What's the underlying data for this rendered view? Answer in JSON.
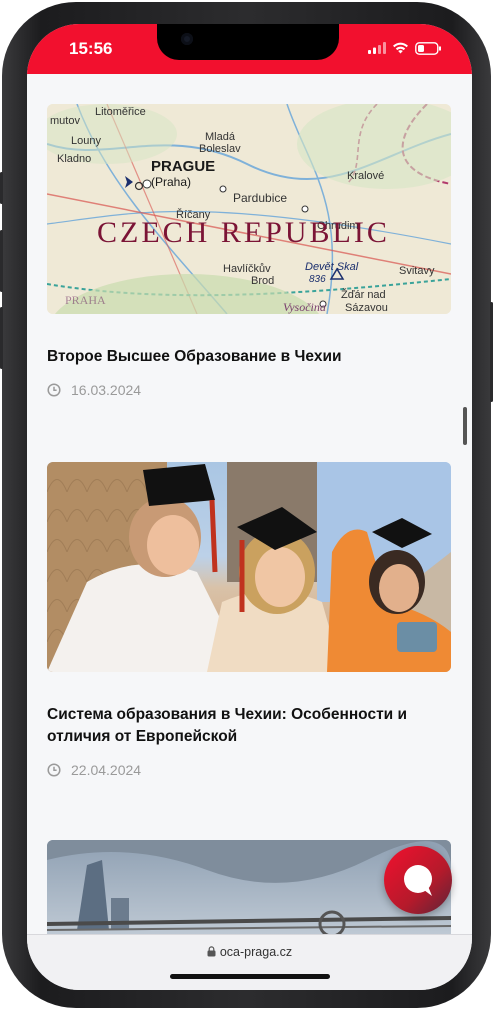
{
  "status_bar": {
    "time": "15:56"
  },
  "articles": [
    {
      "title": "Второе Высшее Образование в Чехии",
      "date": "16.03.2024",
      "image_text": {
        "country": "CZECH REPUBLIC",
        "capital": "PRAGUE",
        "capital_local": "(Praha)",
        "places": [
          "Litoměřice",
          "mutov",
          "Louny",
          "Mladá",
          "Boleslav",
          "Kladno",
          "Pardubice",
          "Říčany",
          "Chrudim",
          "Kralové",
          "Havlíčkův",
          "Brod",
          "Devět Skal",
          "836",
          "Žďár nad",
          "Sázavou",
          "Svitavy",
          "Vysočina",
          "PRAHA"
        ]
      }
    },
    {
      "title": "Система образования в Чехии: Особенности и отличия от Европейской",
      "date": "22.04.2024"
    },
    {
      "title": "",
      "date": ""
    }
  ],
  "browser": {
    "url": "oca-praga.cz"
  },
  "colors": {
    "brand_red": "#f2102e",
    "text": "#111111",
    "muted": "#9a9a9a"
  }
}
